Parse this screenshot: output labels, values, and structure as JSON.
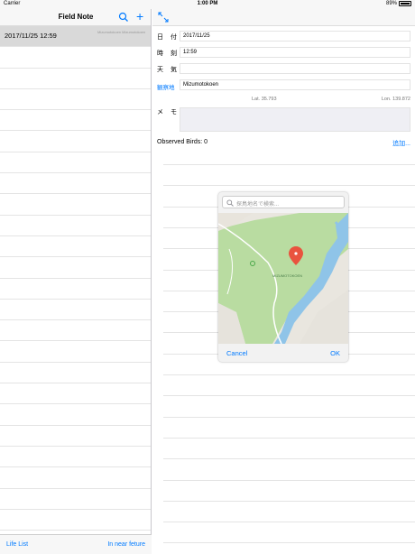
{
  "status_bar": {
    "carrier": "Carrier",
    "time": "1:00 PM",
    "battery": "89%"
  },
  "master": {
    "title": "Field Note",
    "rows": [
      {
        "date": "2017/11/25 12:59",
        "sub": "Mizumotokoen Mizumotokoen"
      }
    ],
    "toolbar": {
      "left": "Life List",
      "right": "In near feture"
    }
  },
  "detail": {
    "date_label": "日 付",
    "date_value": "2017/11/25",
    "time_label": "時 刻",
    "time_value": "12:59",
    "weather_label": "天 気",
    "weather_value": "",
    "place_label": "観察地",
    "place_value": "Mizumotokoen",
    "lat": "Lat. 35.793",
    "lon": "Lon. 139.872",
    "memo_label": "メ モ",
    "observed": "Observed Birds: 0",
    "add": "追加..."
  },
  "popover": {
    "search_placeholder": "探鳥地名で検索...",
    "map_label": "MIZUMOTOKOEN",
    "cancel": "Cancel",
    "ok": "OK"
  },
  "colors": {
    "accent": "#007aff",
    "map_green": "#b9dca1",
    "water": "#8fc4e8",
    "pin": "#e9533e"
  }
}
